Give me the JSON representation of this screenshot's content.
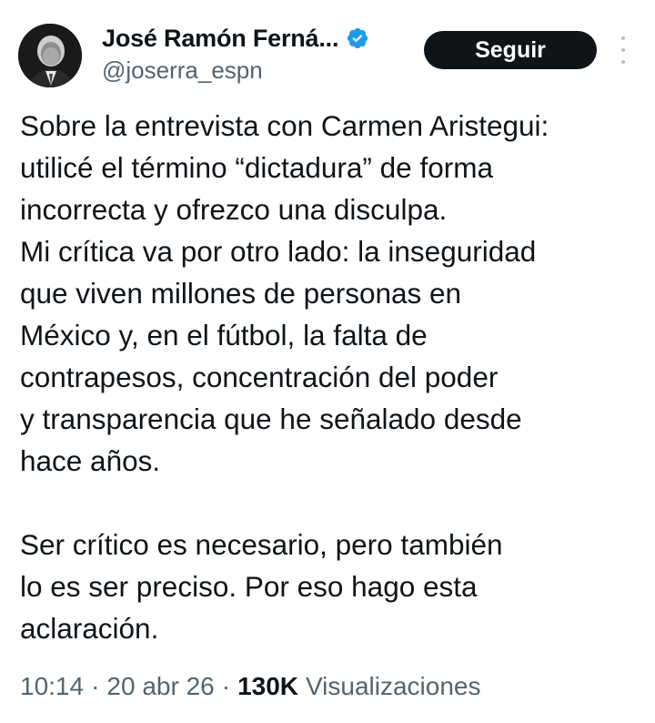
{
  "author": {
    "display_name": "José Ramón Ferná...",
    "handle": "@joserra_espn",
    "verified_icon": "verified-badge-icon",
    "avatar_alt": "avatar"
  },
  "actions": {
    "follow_label": "Seguir",
    "more_icon": "more-options-icon"
  },
  "tweet": {
    "lines": [
      "Sobre la entrevista con Carmen Aristegui:",
      "utilicé el término “dictadura” de forma",
      "incorrecta y ofrezco una disculpa.",
      "Mi crítica va por otro lado: la inseguridad",
      "que viven millones de personas en",
      "México y, en el fútbol, la falta de",
      "contrapesos, concentración del poder",
      "y transparencia que he señalado desde",
      "hace años.",
      "",
      "Ser crítico es necesario, pero también",
      "lo es ser preciso. Por eso hago esta",
      "aclaración."
    ]
  },
  "meta": {
    "time": "10:14",
    "separator": "·",
    "date": "20 abr 26",
    "views_count": "130K",
    "views_label": "Visualizaciones"
  },
  "colors": {
    "text": "#0f1419",
    "secondary": "#536471",
    "verified": "#1d9bf0",
    "button_bg": "#0f1419",
    "button_text": "#ffffff"
  }
}
